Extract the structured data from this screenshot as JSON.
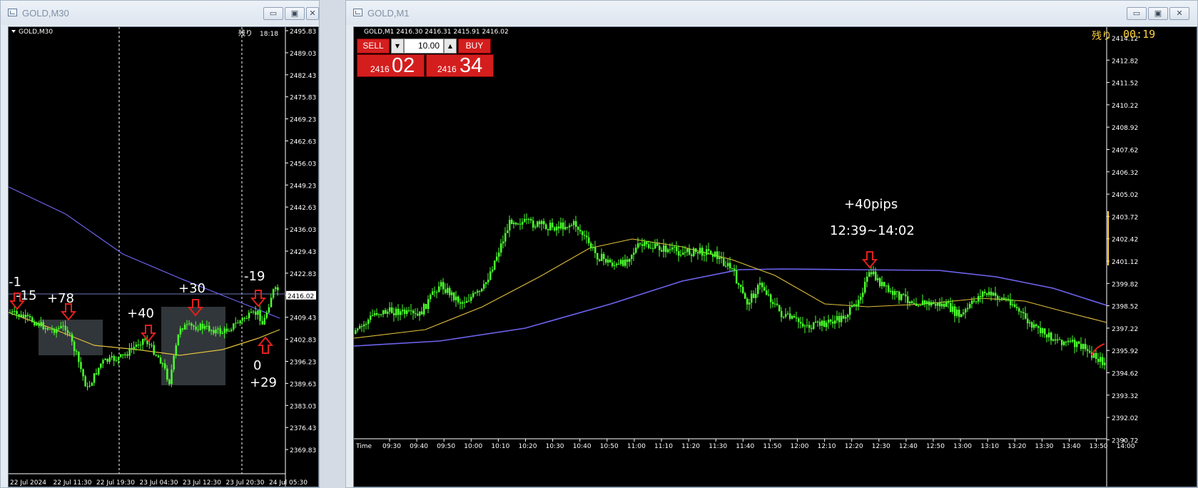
{
  "left_window": {
    "title": "GOLD,M30",
    "buttons": {
      "minimize": "▭",
      "restore": "▣",
      "close": "✕"
    },
    "symbol_label": "GOLD,M30",
    "remaining_label": "残り",
    "remaining_time": "18:18",
    "price_ticks": [
      "2495.83",
      "2489.03",
      "2482.43",
      "2475.83",
      "2469.23",
      "2462.63",
      "2456.03",
      "2449.23",
      "2442.63",
      "2436.03",
      "2429.43",
      "2422.83",
      "2416.02",
      "2409.43",
      "2402.83",
      "2396.23",
      "2389.63",
      "2383.03",
      "2376.43",
      "2369.83"
    ],
    "current_price": "2416.02",
    "time_ticks": [
      "22 Jul 2024",
      "22 Jul 11:30",
      "22 Jul 19:30",
      "23 Jul 04:30",
      "23 Jul 12:30",
      "23 Jul 20:30",
      "24 Jul 05:30"
    ],
    "annotations": [
      "-1",
      "-15",
      "+78",
      "+40",
      "+30",
      "-19",
      "0",
      "+29"
    ]
  },
  "right_window": {
    "title": "GOLD,M1",
    "buttons": {
      "minimize": "▭",
      "restore": "▣",
      "close": "✕"
    },
    "header_info": "GOLD,M1  2416.30 2416.31 2415.91 2416.02",
    "remaining_label": "残り",
    "remaining_time": "00:19",
    "trade_panel": {
      "sell_label": "SELL",
      "buy_label": "BUY",
      "lot_value": "10.00",
      "sell_big": "2416",
      "sell_small": "02",
      "buy_big": "2416",
      "buy_small": "34"
    },
    "price_ticks": [
      "2414.12",
      "2412.82",
      "2411.52",
      "2410.22",
      "2408.92",
      "2407.62",
      "2406.32",
      "2405.02",
      "2403.72",
      "2402.42",
      "2401.12",
      "2399.82",
      "2398.52",
      "2397.22",
      "2395.92",
      "2394.62",
      "2393.32",
      "2392.02",
      "2390.72"
    ],
    "time_ticks": [
      "09:30",
      "09:40",
      "09:50",
      "10:00",
      "10:10",
      "10:20",
      "10:30",
      "10:40",
      "10:50",
      "11:00",
      "11:10",
      "11:20",
      "11:30",
      "11:40",
      "11:50",
      "12:00",
      "12:10",
      "12:20",
      "12:30",
      "12:40",
      "12:50",
      "13:00",
      "13:10",
      "13:20",
      "13:30",
      "13:40",
      "13:50",
      "14:00"
    ],
    "time_axis_label": "Time",
    "annotation_pips": "+40pips",
    "annotation_range": "12:39~14:02"
  },
  "colors": {
    "background": "#000000",
    "candle": "#4cff2e",
    "ma_slow": "#6e64f0",
    "ma_fast": "#e1c03c",
    "annotation": "#ffffff",
    "arrow": "#e0201c",
    "trade_button": "#d41e1e",
    "remaining": "#ffd23c"
  }
}
